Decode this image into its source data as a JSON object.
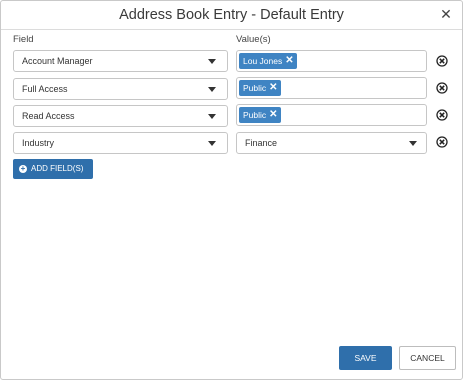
{
  "dialog": {
    "title": "Address Book Entry - Default Entry",
    "close_icon": "close-icon"
  },
  "columns": {
    "field": "Field",
    "values": "Value(s)"
  },
  "rows": [
    {
      "field": "Account Manager",
      "value_type": "chips",
      "chips": [
        "Lou Jones"
      ]
    },
    {
      "field": "Full Access",
      "value_type": "chips",
      "chips": [
        "Public"
      ]
    },
    {
      "field": "Read Access",
      "value_type": "chips",
      "chips": [
        "Public"
      ]
    },
    {
      "field": "Industry",
      "value_type": "select",
      "value": "Finance"
    }
  ],
  "chip_remove_glyph": "✕",
  "add_field": {
    "label": "ADD FIELD(S)",
    "icon": "plus-circle-icon"
  },
  "footer": {
    "save_label": "SAVE",
    "cancel_label": "CANCEL"
  },
  "colors": {
    "accent": "#2f6fab",
    "chip": "#3f84c3"
  }
}
